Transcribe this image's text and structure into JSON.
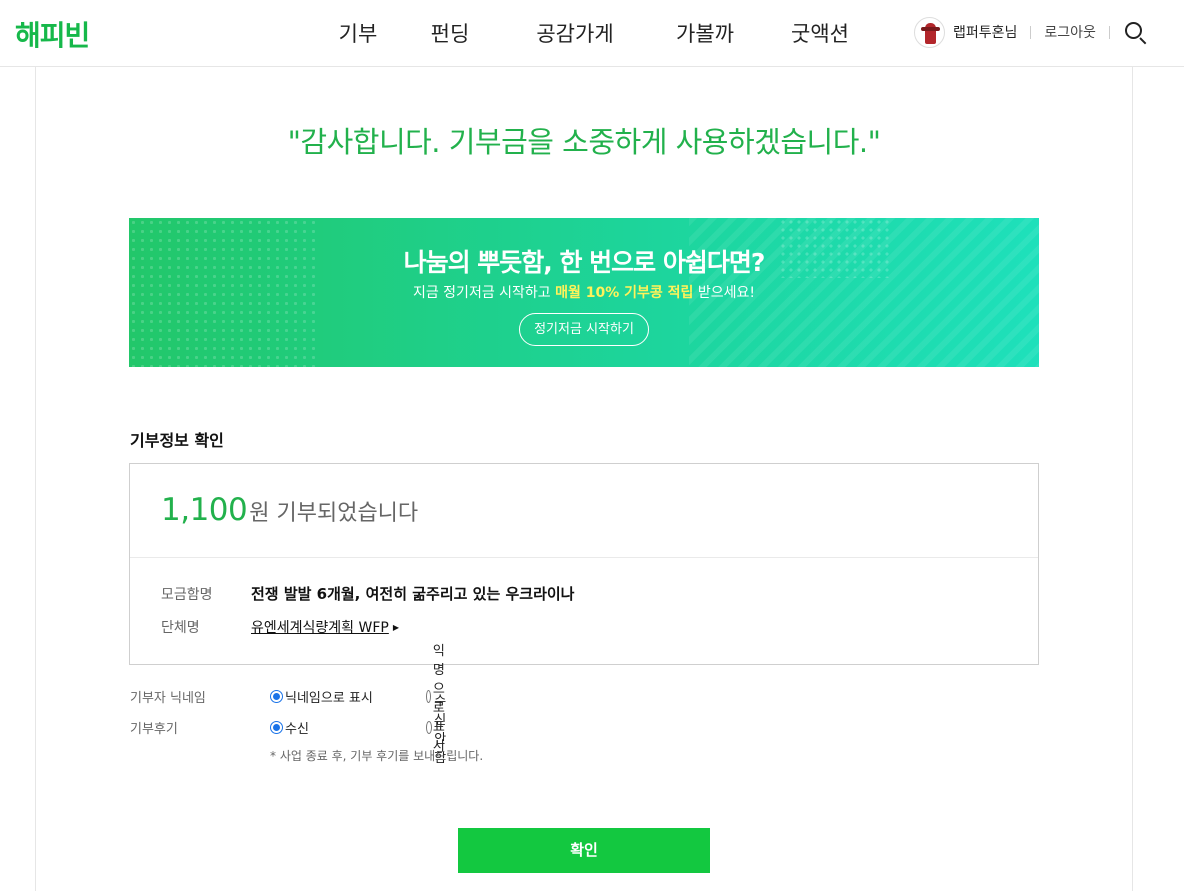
{
  "header": {
    "logo": "해피빈",
    "nav": [
      "기부",
      "펀딩",
      "공감가게",
      "가볼까",
      "굿액션"
    ],
    "username": "랩퍼투혼님",
    "logout": "로그아웃"
  },
  "main": {
    "thanks": "\"감사합니다. 기부금을 소중하게 사용하겠습니다.\"",
    "banner": {
      "title": "나눔의 뿌듯함, 한 번으로 아쉽다면?",
      "sub_before": "지금 정기저금 시작하고 ",
      "sub_highlight": "매월 10% 기부콩 적립",
      "sub_after": " 받으세요!",
      "button": "정기저금 시작하기"
    },
    "section_title": "기부정보 확인",
    "donation": {
      "amount": "1,100",
      "amount_suffix": "원 기부되었습니다",
      "campaign_label": "모금함명",
      "campaign_value": "전쟁 발발 6개월, 여전히 굶주리고 있는 우크라이나",
      "org_label": "단체명",
      "org_value": "유엔세계식량계획 WFP"
    },
    "options": {
      "nickname_label": "기부자 닉네임",
      "nickname_opt1": "닉네임으로 표시",
      "nickname_opt2": "익명으로 표시",
      "review_label": "기부후기",
      "review_opt1": "수신",
      "review_opt2": "수신안함",
      "note": "* 사업 종료 후, 기부 후기를 보내드립니다."
    },
    "confirm": "확인"
  },
  "colors": {
    "brand_green": "#16b84a",
    "confirm_green": "#13c840",
    "radio_blue": "#1a73e8"
  }
}
